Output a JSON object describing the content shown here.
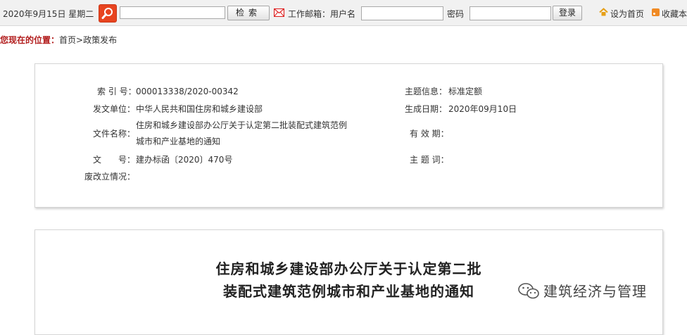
{
  "topbar": {
    "date": "2020年9月15日 星期二",
    "search_placeholder": "",
    "search_button": "检索",
    "mail_label": "工作邮箱：用户名",
    "username_value": "",
    "password_label": "密码",
    "password_value": "",
    "login_button": "登录",
    "set_home": "设为首页",
    "favorite": "收藏本",
    "colors": {
      "search_accent": "#e8441f",
      "mail_icon": "#d22",
      "home_icon": "#e6a018",
      "rss_icon": "#f08a24"
    }
  },
  "breadcrumb": {
    "here_label": "您现在的位置：",
    "home": "首页",
    "sep": ">",
    "current": "政策发布"
  },
  "info": {
    "index_label": "索 引 号：",
    "index_value": "000013338/2020-00342",
    "topic_label": "主题信息：",
    "topic_value": "标准定额",
    "issuer_label": "发文单位：",
    "issuer_value": "中华人民共和国住房和城乡建设部",
    "date_label": "生成日期：",
    "date_value": "2020年09月10日",
    "filename_label": "文件名称：",
    "filename_line1": "住房和城乡建设部办公厅关于认定第二批装配式建筑范例",
    "filename_line2": "城市和产业基地的通知",
    "valid_label": "有 效 期：",
    "valid_value": "",
    "docno_label": "文　　号：",
    "docno_value": "建办标函〔2020〕470号",
    "keyword_label": "主 题 词：",
    "keyword_value": "",
    "status_label": "废改立情况：",
    "status_value": ""
  },
  "article": {
    "title_line1": "住房和城乡建设部办公厅关于认定第二批",
    "title_line2": "装配式建筑范例城市和产业基地的通知"
  },
  "watermark": {
    "text": "建筑经济与管理",
    "icon": "wechat-icon"
  }
}
